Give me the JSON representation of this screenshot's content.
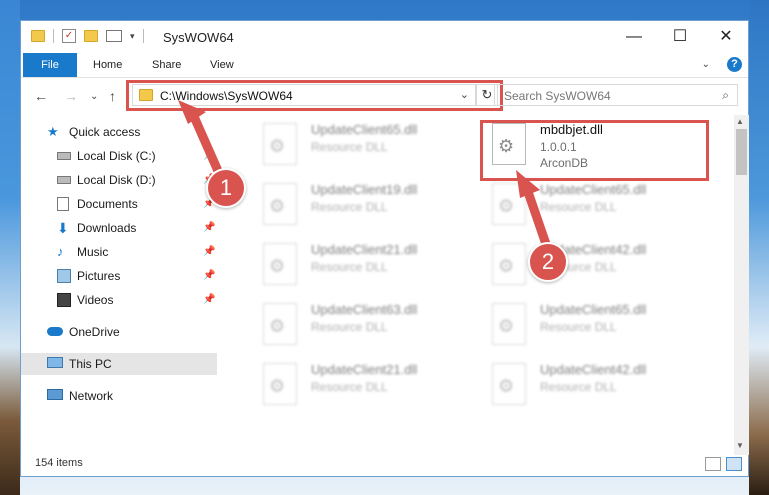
{
  "window": {
    "title": "SysWOW64",
    "minimize_icon": "minimize-icon",
    "maximize_icon": "maximize-icon",
    "close_icon": "close-icon"
  },
  "ribbon": {
    "tabs": [
      "File",
      "Home",
      "Share",
      "View"
    ]
  },
  "navigation": {
    "address": "C:\\Windows\\SysWOW64",
    "search_placeholder": "Search SysWOW64"
  },
  "sidebar": {
    "items": [
      {
        "label": "Quick access",
        "icon": "star-icon"
      },
      {
        "label": "Local Disk (C:)",
        "icon": "drive-icon"
      },
      {
        "label": "Local Disk (D:)",
        "icon": "drive-icon"
      },
      {
        "label": "Documents",
        "icon": "documents-icon"
      },
      {
        "label": "Downloads",
        "icon": "downloads-icon"
      },
      {
        "label": "Music",
        "icon": "music-icon"
      },
      {
        "label": "Pictures",
        "icon": "pictures-icon"
      },
      {
        "label": "Videos",
        "icon": "videos-icon"
      },
      {
        "label": "OneDrive",
        "icon": "cloud-icon"
      },
      {
        "label": "This PC",
        "icon": "computer-icon"
      },
      {
        "label": "Network",
        "icon": "network-icon"
      }
    ]
  },
  "files": {
    "left": [
      {
        "name": "UpdateClient65.dll",
        "type": "Resource DLL"
      },
      {
        "name": "UpdateClient19.dll",
        "type": "Resource DLL"
      },
      {
        "name": "UpdateClient21.dll",
        "type": "Resource DLL"
      },
      {
        "name": "UpdateClient63.dll",
        "type": "Resource DLL"
      },
      {
        "name": "UpdateClient21.dll",
        "type": "Resource DLL"
      }
    ],
    "right": [
      {
        "name": "mbdbjet.dll",
        "version": "1.0.0.1",
        "company": "ArconDB"
      },
      {
        "name": "UpdateClient65.dll",
        "type": "Resource DLL"
      },
      {
        "name": "UpdateClient42.dll",
        "type": "Resource DLL"
      },
      {
        "name": "UpdateClient65.dll",
        "type": "Resource DLL"
      },
      {
        "name": "UpdateClient42.dll",
        "type": "Resource DLL"
      }
    ]
  },
  "status": {
    "items_count": "154 items"
  },
  "annotations": {
    "marker1": "1",
    "marker2": "2",
    "highlight_color": "#d9534f"
  },
  "colors": {
    "accent": "#1979ca"
  }
}
